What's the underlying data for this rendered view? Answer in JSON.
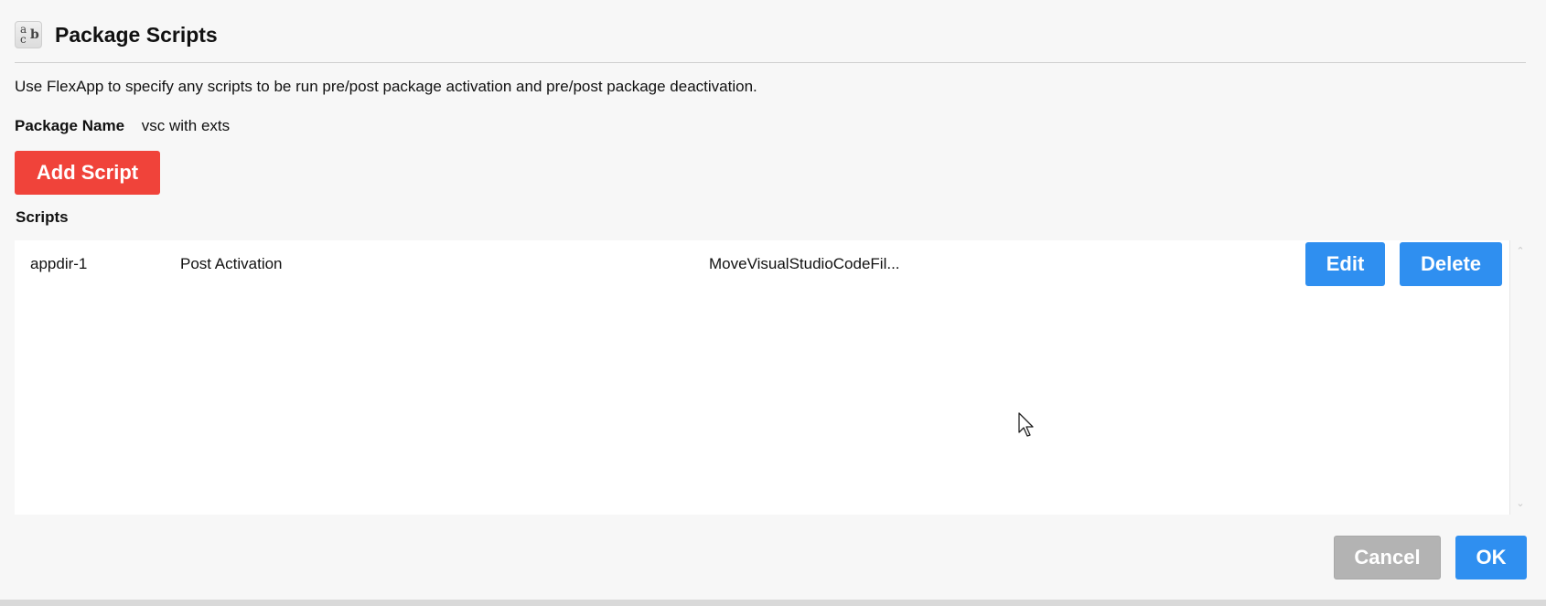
{
  "dialog": {
    "title": "Package Scripts",
    "icon": "text-case-icon",
    "icon_glyphs": {
      "top": "a",
      "bottom": "c",
      "right": "b"
    },
    "description": "Use FlexApp to specify any scripts to be run pre/post package activation and pre/post package deactivation."
  },
  "package": {
    "label": "Package Name",
    "value": "vsc with exts"
  },
  "actions": {
    "add_script_label": "Add Script"
  },
  "scripts": {
    "label": "Scripts",
    "rows": [
      {
        "name": "appdir-1",
        "type": "Post Activation",
        "file": "MoveVisualStudioCodeFil...",
        "edit_label": "Edit",
        "delete_label": "Delete"
      }
    ]
  },
  "footer": {
    "cancel_label": "Cancel",
    "ok_label": "OK"
  },
  "colors": {
    "primary": "#2f8ff0",
    "danger": "#f0433a",
    "disabled": "#b3b3b3",
    "background": "#f7f7f7"
  }
}
